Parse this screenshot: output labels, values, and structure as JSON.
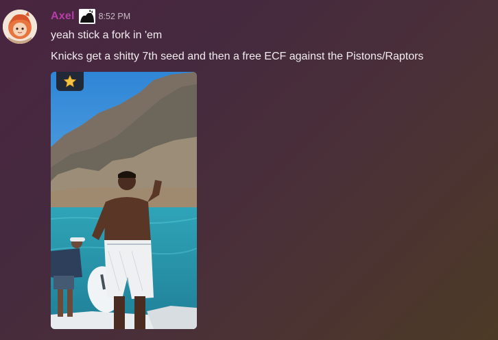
{
  "message": {
    "author": "Axel",
    "timestamp": "8:52 PM",
    "lines": [
      "yeah stick a fork in 'em",
      "Knicks get a shitty 7th seed and then a free ECF against the Pistons/Raptors"
    ]
  },
  "colors": {
    "username": "#b63ea8",
    "text": "#f2ecef",
    "timestamp": "#c7bcc4"
  },
  "icons": {
    "favorite": "star-icon",
    "avatar": "user-avatar",
    "badge": "role-icon"
  }
}
